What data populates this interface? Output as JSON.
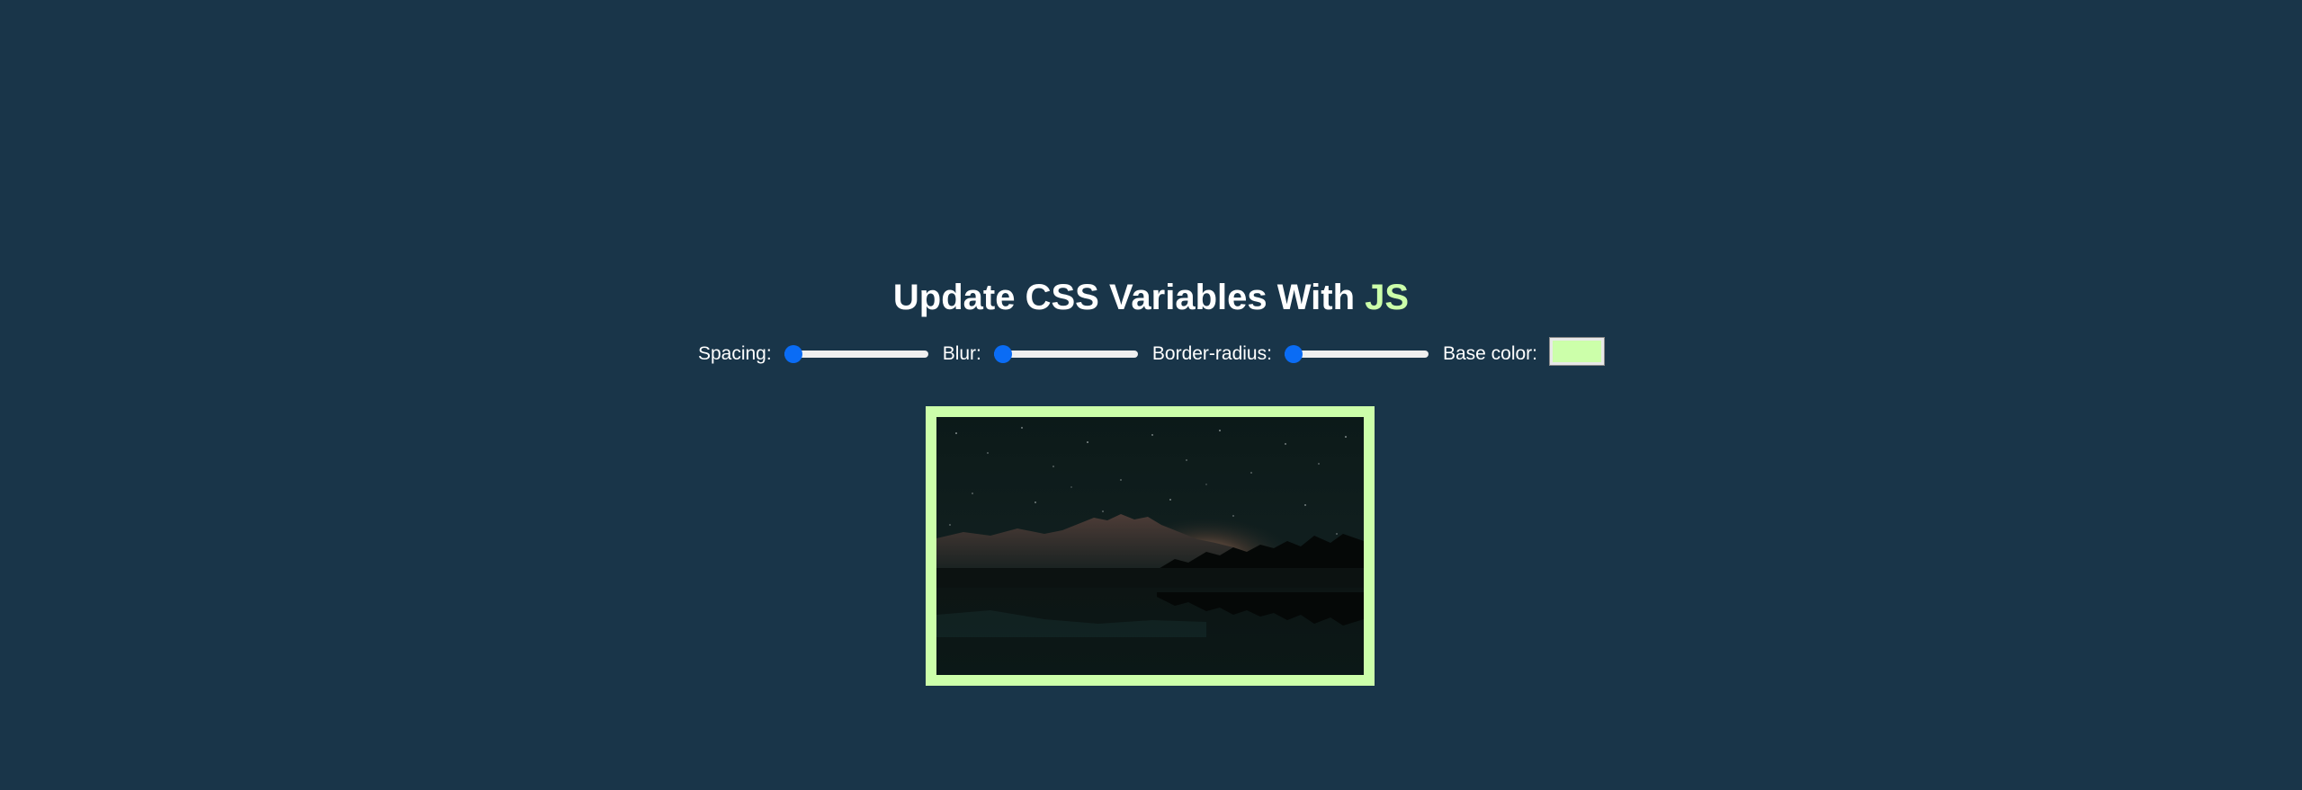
{
  "heading": {
    "text": "Update CSS Variables With ",
    "highlight": "JS"
  },
  "controls": {
    "spacing": {
      "label": "Spacing:",
      "value": 10,
      "min": 10,
      "max": 200
    },
    "blur": {
      "label": "Blur:",
      "value": 0,
      "min": 0,
      "max": 25
    },
    "border_radius": {
      "label": "Border-radius:",
      "value": 0,
      "min": 0,
      "max": 50
    },
    "base_color": {
      "label": "Base color:",
      "value": "#ccffaa"
    }
  },
  "image": {
    "alt": "night sky mountain landscape"
  },
  "colors": {
    "background": "#193549",
    "accent": "#ccffaa",
    "slider_accent": "#0a6cf5"
  }
}
